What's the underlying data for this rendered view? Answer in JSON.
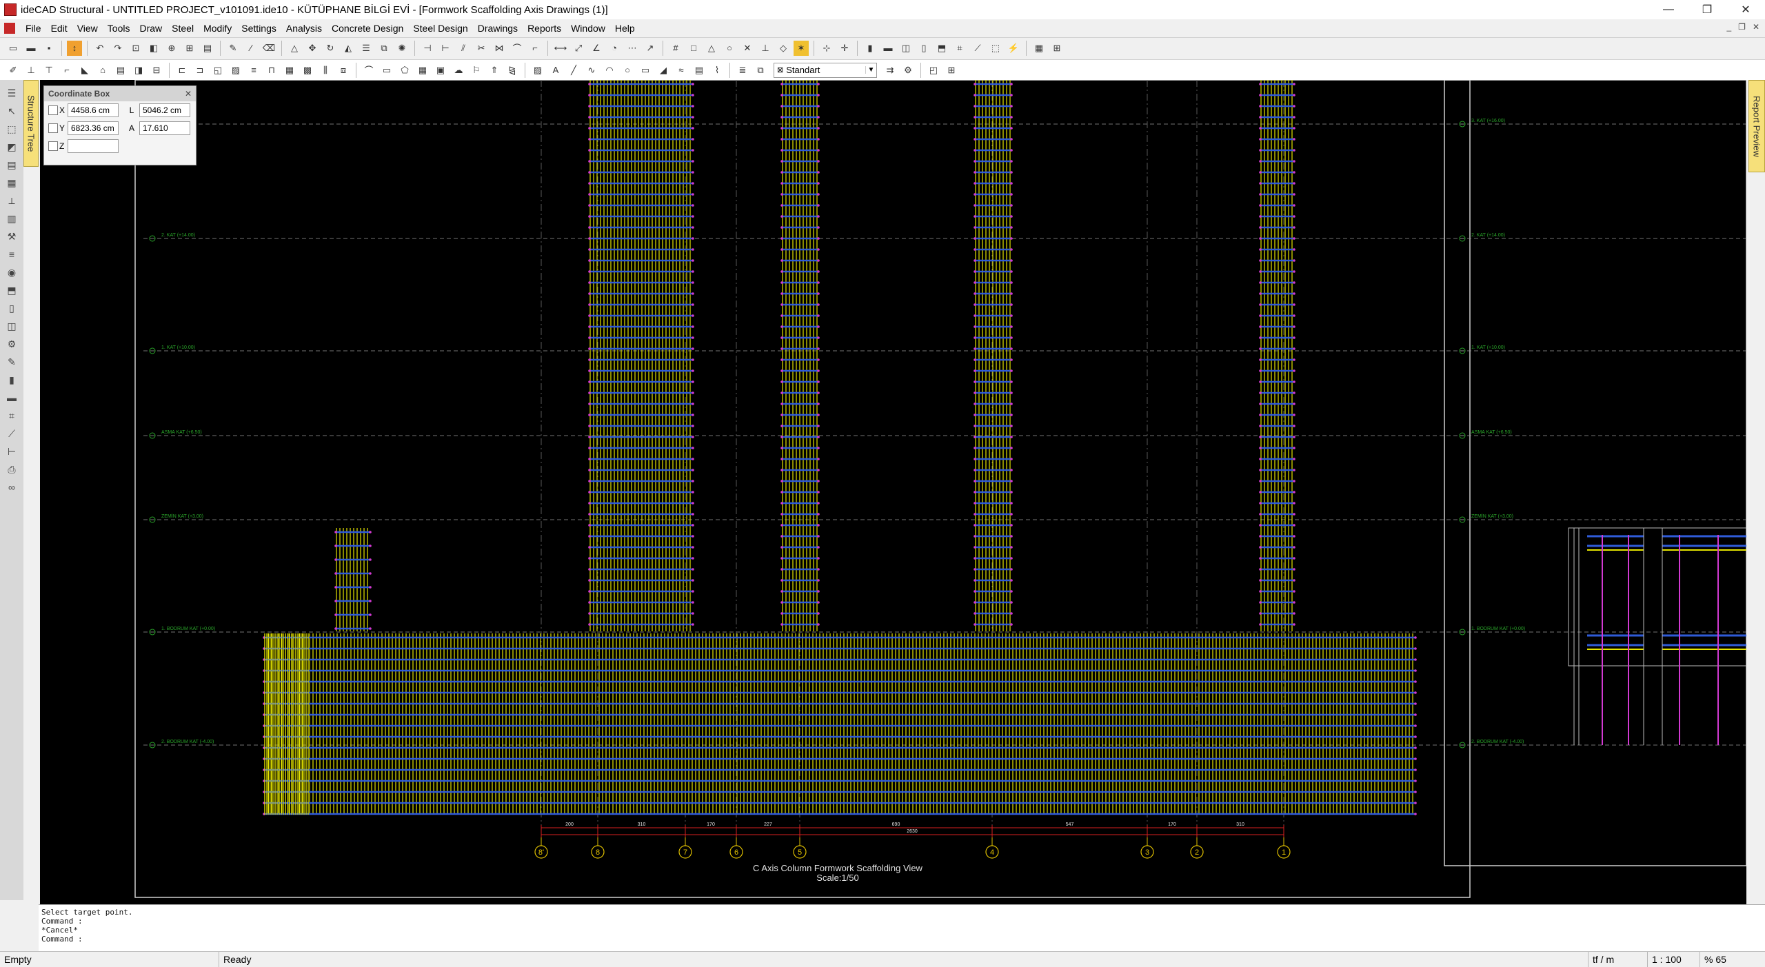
{
  "window": {
    "title": "ideCAD Structural - UNTITLED PROJECT_v101091.ide10 - KÜTÜPHANE BİLGİ EVİ - [Formwork Scaffolding Axis Drawings (1)]",
    "minimize": "—",
    "maximize": "❐",
    "close": "✕"
  },
  "menu": [
    "File",
    "Edit",
    "View",
    "Tools",
    "Draw",
    "Steel",
    "Modify",
    "Settings",
    "Analysis",
    "Concrete Design",
    "Steel Design",
    "Drawings",
    "Reports",
    "Window",
    "Help"
  ],
  "toolbar": {
    "style_select": "Standart"
  },
  "side_tabs": {
    "structure_tree": "Structure Tree",
    "report_preview": "Report Preview"
  },
  "coordinate_box": {
    "title": "Coordinate Box",
    "close": "✕",
    "x_label": "X",
    "x_value": "4458.6 cm",
    "y_label": "Y",
    "y_value": "6823.36 cm",
    "z_label": "Z",
    "z_value": "",
    "l_label": "L",
    "l_value": "5046.2 cm",
    "a_label": "A",
    "a_value": "17.610"
  },
  "drawing": {
    "view_title": "C Axis Column Formwork Scaffolding View",
    "scale": "Scale:1/50",
    "levels": [
      "3. KAT (+16.00)",
      "2. KAT (+14.00)",
      "1. KAT (+10.00)",
      "ASMA KAT (+6.50)",
      "ZEMİN KAT (+3.00)",
      "1. BODRUM KAT (+0.00)",
      "2. BODRUM KAT (-4.00)"
    ],
    "axes": [
      "8'",
      "8",
      "7",
      "6",
      "5",
      "4",
      "3",
      "2",
      "1"
    ],
    "dimensions": [
      "200",
      "310",
      "170",
      "227",
      "690",
      "547",
      "170",
      "310"
    ],
    "total_dimension": "2630"
  },
  "command_panel": {
    "lines": [
      "Select target point.",
      "Command :",
      "*Cancel*",
      "Command :"
    ]
  },
  "status": {
    "left": "Empty",
    "state": "Ready",
    "unit": "tf / m",
    "scale": "1 : 100",
    "zoom": "% 65"
  },
  "colors": {
    "canvas": "#000000",
    "scaffold": "#e6e600",
    "ledger": "#2f5bd8",
    "coupler": "#d33ad3",
    "level_line": "#2aa52a",
    "dimension": "#d62020",
    "axis_bubble": "#e0c000"
  }
}
